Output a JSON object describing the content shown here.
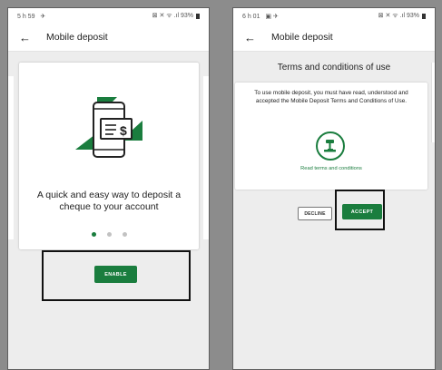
{
  "left_screen": {
    "status": {
      "time": "5 h 59",
      "extra": "✈",
      "indicators": "⊠ ✕ ᯤ .ıl 93%"
    },
    "appbar": {
      "title": "Mobile deposit"
    },
    "intro": {
      "text": "A quick and easy way to deposit a cheque to your account"
    },
    "carousel": {
      "count": 3,
      "active": 1
    },
    "enable_label": "ENABLE"
  },
  "right_screen": {
    "status": {
      "time": "6 h 01",
      "extra": "▣ ✈",
      "indicators": "⊠ ✕ ᯤ .ıl 93%"
    },
    "appbar": {
      "title": "Mobile deposit"
    },
    "terms": {
      "header": "Terms and conditions of use",
      "body": "To use mobile deposit, you must have read, understood and accepted the Mobile Deposit Terms and Conditions of Use.",
      "read_link": "Read terms and conditions"
    },
    "decline_label": "DECLINE",
    "accept_label": "ACCEPT"
  },
  "colors": {
    "brand_green": "#1a7d3e",
    "highlight": "#111111"
  }
}
